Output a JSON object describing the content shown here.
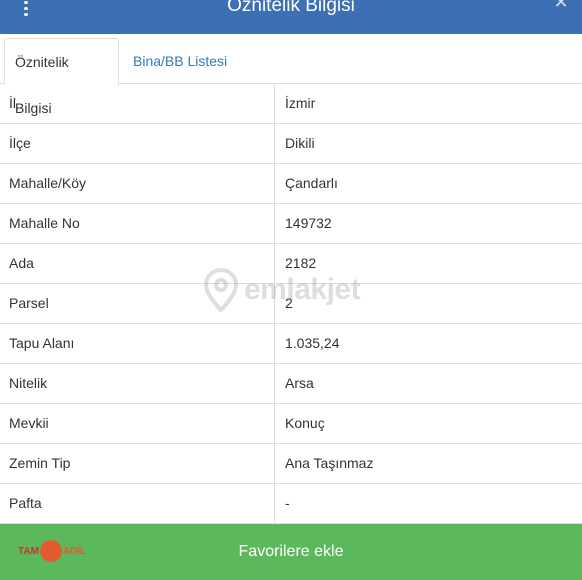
{
  "header": {
    "title": "Öznitelik Bilgisi"
  },
  "tabs": [
    {
      "label": "Öznitelik Bilgisi",
      "active": true
    },
    {
      "label": "Bina/BB Listesi",
      "active": false
    }
  ],
  "rows": [
    {
      "key": "İl",
      "value": "İzmir"
    },
    {
      "key": "İlçe",
      "value": "Dikili"
    },
    {
      "key": "Mahalle/Köy",
      "value": "Çandarlı"
    },
    {
      "key": "Mahalle No",
      "value": "149732"
    },
    {
      "key": "Ada",
      "value": "2182"
    },
    {
      "key": "Parsel",
      "value": "2"
    },
    {
      "key": "Tapu Alanı",
      "value": "1.035,24"
    },
    {
      "key": "Nitelik",
      "value": "Arsa"
    },
    {
      "key": "Mevkii",
      "value": "Konuç"
    },
    {
      "key": "Zemin Tip",
      "value": "Ana Taşınmaz"
    },
    {
      "key": "Pafta",
      "value": "-"
    }
  ],
  "watermark": {
    "text": "emlakjet",
    "icon": "location-pin-icon"
  },
  "footer": {
    "favorite_label": "Favorilere ekle",
    "logo_left": "TAM",
    "logo_right": "ADİL"
  },
  "colors": {
    "header_bg": "#3d6fb4",
    "tab_link": "#337ab7",
    "footer_bg": "#5cb85c"
  },
  "icons": {
    "menu": "kebab-menu-icon",
    "close": "close-icon"
  }
}
